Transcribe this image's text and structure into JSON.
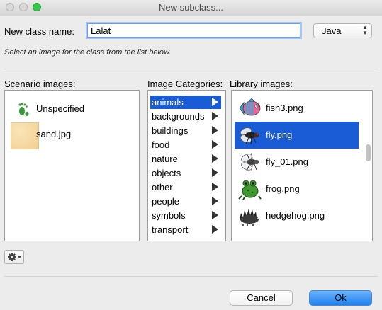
{
  "window": {
    "title": "New subclass..."
  },
  "form": {
    "class_name_label": "New class name:",
    "class_name_value": "Lalat",
    "language": "Java",
    "hint": "Select an image for the class from the list below."
  },
  "scenario": {
    "label": "Scenario images:",
    "items": [
      {
        "label": "Unspecified",
        "icon": "footprint-icon"
      },
      {
        "label": "sand.jpg",
        "icon": "sand-thumbnail"
      }
    ]
  },
  "categories": {
    "label": "Image Categories:",
    "items": [
      "animals",
      "backgrounds",
      "buildings",
      "food",
      "nature",
      "objects",
      "other",
      "people",
      "symbols",
      "transport"
    ],
    "selected": "animals"
  },
  "library": {
    "label": "Library images:",
    "items": [
      {
        "label": "fish3.png",
        "icon": "fish-icon"
      },
      {
        "label": "fly.png",
        "icon": "fly-icon"
      },
      {
        "label": "fly_01.png",
        "icon": "fly-icon"
      },
      {
        "label": "frog.png",
        "icon": "frog-icon"
      },
      {
        "label": "hedgehog.png",
        "icon": "hedgehog-icon"
      }
    ],
    "selected": "fly.png"
  },
  "buttons": {
    "cancel": "Cancel",
    "ok": "Ok",
    "gear_icon": "gear-icon"
  },
  "colors": {
    "selection": "#1a5cd6",
    "focus_ring": "#a5c7f3",
    "default_button": "#1d80ef"
  }
}
